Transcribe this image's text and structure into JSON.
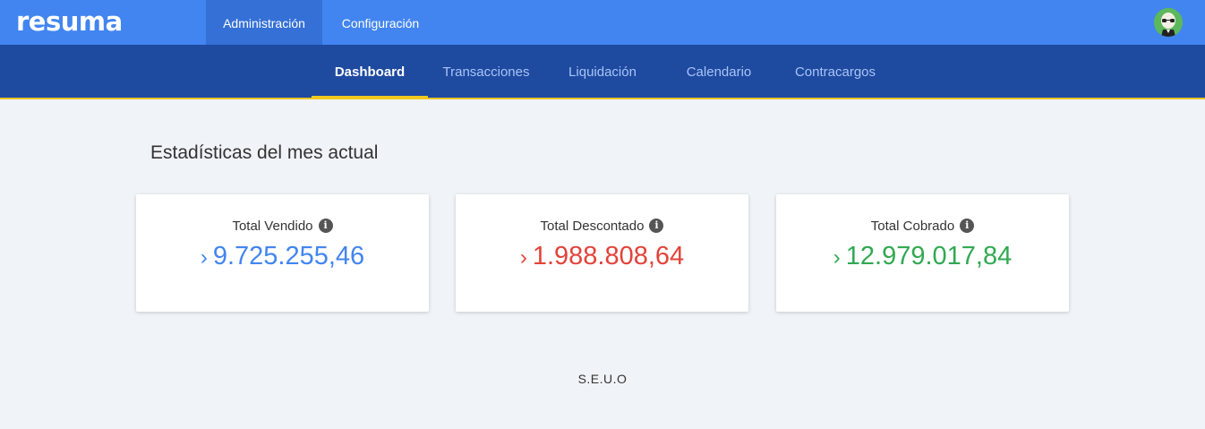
{
  "app": {
    "logo": "resuma"
  },
  "topnav": {
    "tabs": [
      {
        "label": "Administración",
        "active": true
      },
      {
        "label": "Configuración",
        "active": false
      }
    ]
  },
  "subnav": {
    "tabs": [
      {
        "label": "Dashboard",
        "active": true
      },
      {
        "label": "Transacciones",
        "active": false
      },
      {
        "label": "Liquidación",
        "active": false
      },
      {
        "label": "Calendario",
        "active": false
      },
      {
        "label": "Contracargos",
        "active": false
      }
    ]
  },
  "main": {
    "title": "Estadísticas del mes actual",
    "cards": [
      {
        "label": "Total Vendido",
        "value": "9.725.255,46",
        "arrow": "›",
        "color": "#4285f0"
      },
      {
        "label": "Total Descontado",
        "value": "1.988.808,64",
        "arrow": "›",
        "color": "#e2433a"
      },
      {
        "label": "Total Cobrado",
        "value": "12.979.017,84",
        "arrow": "›",
        "color": "#31a952"
      }
    ],
    "info_icon_glyph": "i"
  },
  "footer": {
    "text": "S.E.U.O"
  },
  "colors": {
    "topbar": "#4285f0",
    "subnav": "#1e4aa0",
    "accent": "#f2c81f"
  }
}
